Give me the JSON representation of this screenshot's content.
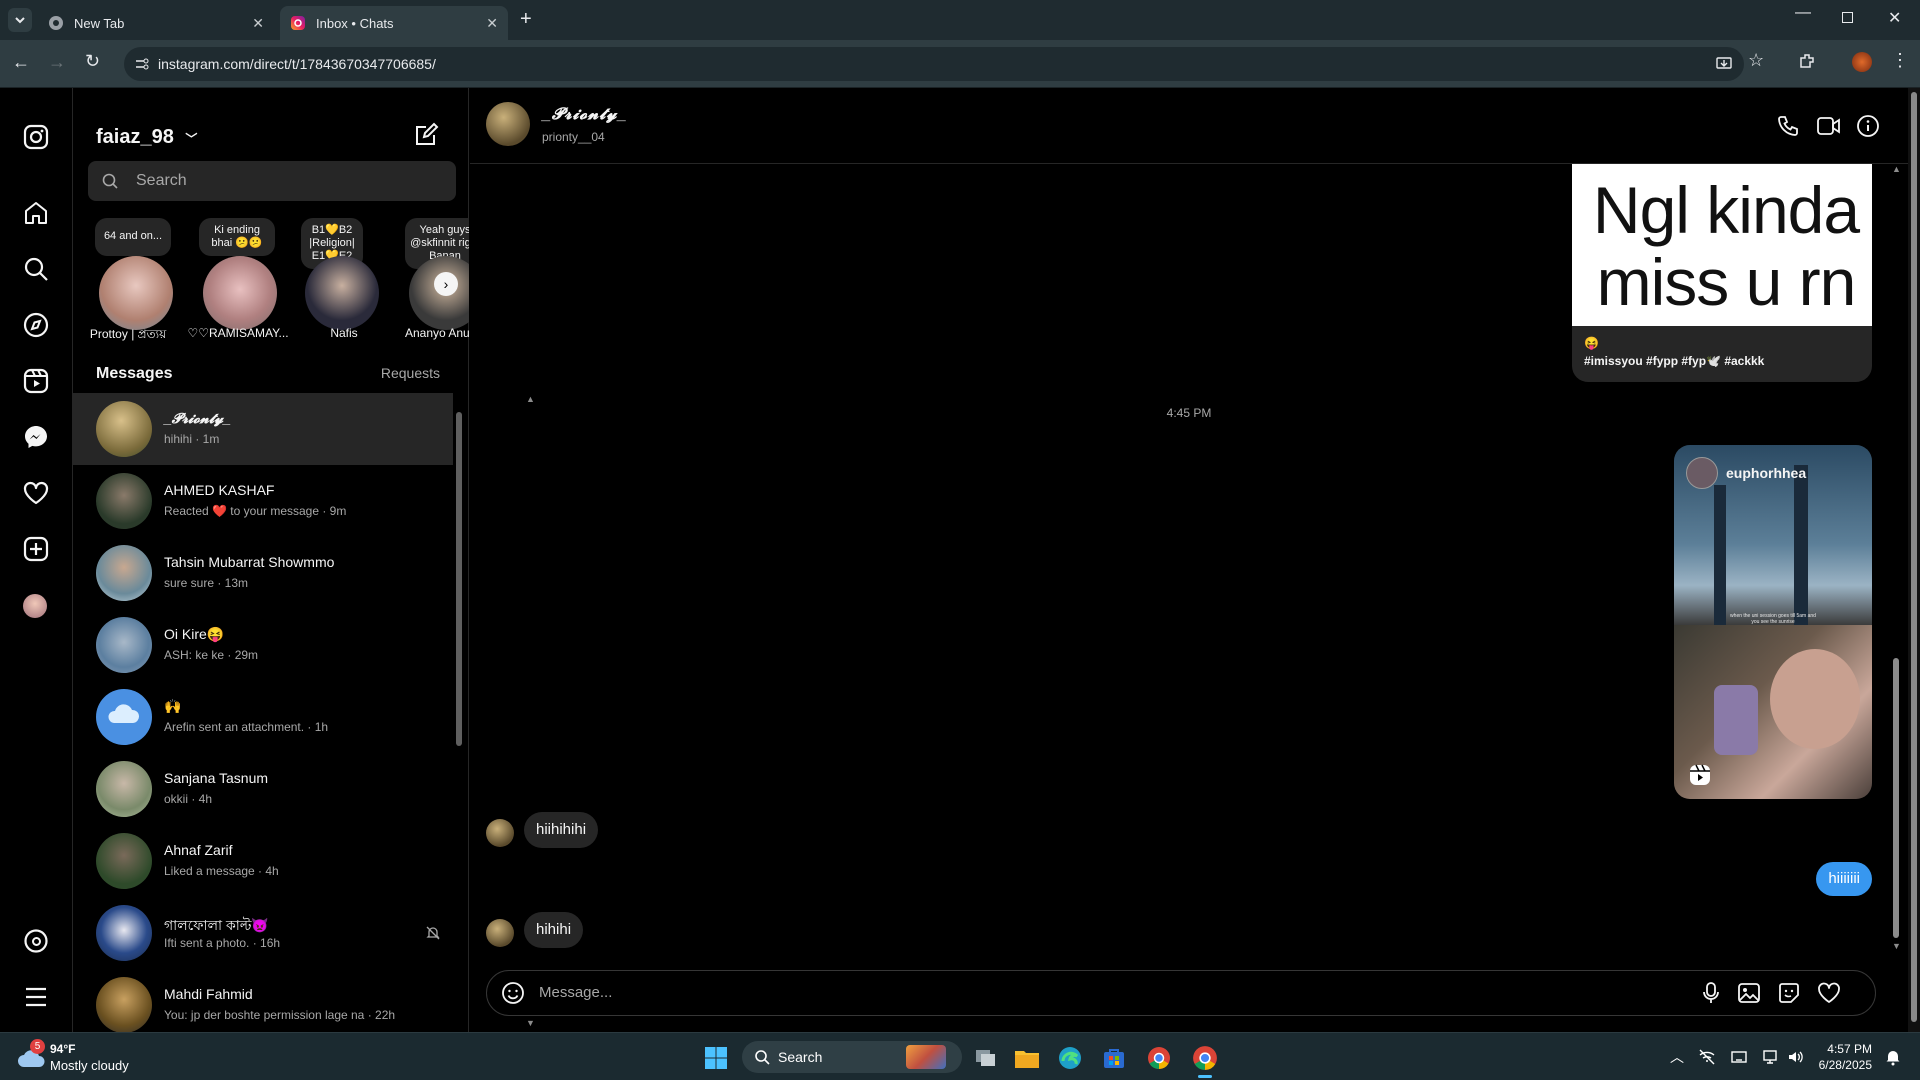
{
  "browser": {
    "tabs": [
      {
        "label": "New Tab"
      },
      {
        "label": "Inbox • Chats"
      }
    ],
    "url": "instagram.com/direct/t/17843670347706685/"
  },
  "inbox": {
    "username": "faiaz_98",
    "search_placeholder": "Search",
    "notes": [
      {
        "text": "64 and on...",
        "name": "Prottoy | প্রত্যয়"
      },
      {
        "text": "Ki ending bhai 😕😕",
        "name": "♡♡RAMISAMAY..."
      },
      {
        "text": "B1💛B2 |Religion| E1💛E2",
        "name": "Nafis"
      },
      {
        "text": "Yeah guys @skfinnit right Banan",
        "name": "Ananyo Anu"
      }
    ],
    "messages_heading": "Messages",
    "requests_label": "Requests",
    "conversations": [
      {
        "name": "_𝓟𝓻𝓲𝓸𝓷𝓽𝔂_",
        "preview": "hihihi · 1m",
        "selected": true,
        "color": "#9b8a5a"
      },
      {
        "name": "AHMED KASHAF",
        "preview": "Reacted ❤️ to your message · 9m",
        "color": "#3a4a3a"
      },
      {
        "name": "Tahsin Mubarrat Showmmo",
        "preview": "sure sure · 13m",
        "color": "#6a8a9a"
      },
      {
        "name": "Oi Kire😝",
        "preview": "ASH: ke ke · 29m",
        "color": "#5c7fa0"
      },
      {
        "name": "🙌",
        "preview": "Arefin sent an attachment. · 1h",
        "color": "#4a90e2"
      },
      {
        "name": "Sanjana Tasnum",
        "preview": "okkii · 4h",
        "color": "#8a9a7a"
      },
      {
        "name": "Ahnaf Zarif",
        "preview": "Liked a message · 4h",
        "color": "#3e5a3a"
      },
      {
        "name": "গালফোলা কাল্ট👿",
        "preview": "Ifti sent a photo. · 16h",
        "color": "#2a4a8a"
      },
      {
        "name": "Mahdi Fahmid",
        "preview": "You: jp der boshte permission lage na · 22h",
        "color": "#c9a040"
      }
    ]
  },
  "chat": {
    "display_name": "_𝓟𝓻𝓲𝓸𝓷𝓽𝔂_",
    "username": "prionty__04",
    "reel1_text": "Ngl kinda miss u rn",
    "reel1_caption_emoji": "😝",
    "reel1_caption": "#imissyou #fypp #fyp🕊️ #ackkk",
    "timestamp": "4:45 PM",
    "reel2_user": "euphorhhea",
    "reel2_caption": "when the uni session goes till 5am and you see the sunrise",
    "incoming1": "hiihihihi",
    "outgoing": "hiiiiiii",
    "incoming2": "hihihi",
    "composer_placeholder": "Message..."
  },
  "taskbar": {
    "weather_temp": "94°F",
    "weather_desc": "Mostly cloudy",
    "weather_badge": "5",
    "search_label": "Search",
    "time": "4:57 PM",
    "date": "6/28/2025"
  }
}
